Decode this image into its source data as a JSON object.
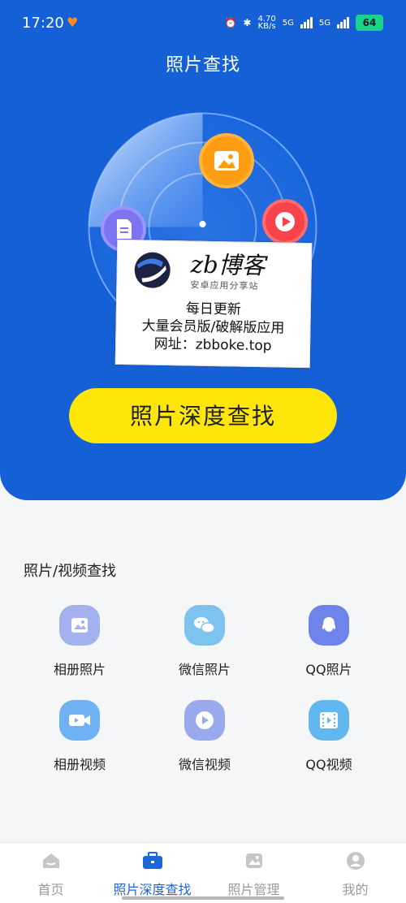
{
  "status_bar": {
    "time": "17:20",
    "net_speed_top": "4.70",
    "net_speed_bottom": "KB/s",
    "sim1": "5G",
    "sim2": "5G",
    "battery": "64",
    "icons": [
      "heart-icon",
      "alarm-icon",
      "bluetooth-icon",
      "signal-icon",
      "battery-icon"
    ]
  },
  "header": {
    "title": "照片查找"
  },
  "radar": {
    "icons": [
      "document-icon",
      "image-icon",
      "play-icon"
    ]
  },
  "hero_button": {
    "label": "照片深度查找"
  },
  "watermark": {
    "brand": "zb博客",
    "subtitle": "安卓应用分享站",
    "line1": "每日更新",
    "line2": "大量会员版/破解版应用",
    "line3": "网址：zbboke.top"
  },
  "section": {
    "title": "照片/视频查找",
    "items": [
      {
        "label": "相册照片",
        "icon": "album-photo-icon"
      },
      {
        "label": "微信照片",
        "icon": "wechat-icon"
      },
      {
        "label": "QQ照片",
        "icon": "qq-icon"
      },
      {
        "label": "相册视频",
        "icon": "video-camera-icon"
      },
      {
        "label": "微信视频",
        "icon": "play-circle-icon"
      },
      {
        "label": "QQ视频",
        "icon": "film-icon"
      }
    ]
  },
  "bottom_nav": {
    "items": [
      {
        "label": "首页",
        "icon": "home-icon",
        "active": false
      },
      {
        "label": "照片深度查找",
        "icon": "briefcase-icon",
        "active": true
      },
      {
        "label": "照片管理",
        "icon": "image-manage-icon",
        "active": false
      },
      {
        "label": "我的",
        "icon": "profile-icon",
        "active": false
      }
    ]
  },
  "colors": {
    "brand_blue": "#1560d6",
    "yellow": "#ffe60a",
    "active_nav": "#1e65d7",
    "orange": "#ff9d12",
    "red": "#f8434a",
    "violet": "#7d74f2"
  }
}
